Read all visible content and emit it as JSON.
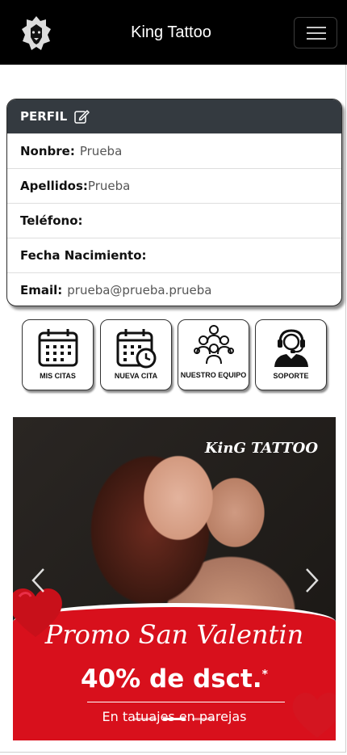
{
  "navbar": {
    "brand": "King Tattoo",
    "logo_icon": "lion-logo-icon",
    "menu_icon": "hamburger-icon"
  },
  "profile": {
    "title": "PERFIL",
    "edit_icon": "edit-icon",
    "fields": [
      {
        "label": "Nonbre:",
        "value": "Prueba"
      },
      {
        "label": "Apellidos:",
        "value": "Prueba"
      },
      {
        "label": "Teléfono:",
        "value": ""
      },
      {
        "label": "Fecha Nacimiento:",
        "value": ""
      },
      {
        "label": "Email:",
        "value": "prueba@prueba.prueba"
      }
    ]
  },
  "actions": [
    {
      "label": "MIS CITAS",
      "icon": "calendar-icon"
    },
    {
      "label": "NUEVA CITA",
      "icon": "calendar-clock-icon"
    },
    {
      "label": "NUESTRO EQUIPO",
      "icon": "team-icon"
    },
    {
      "label": "SOPORTE",
      "icon": "support-headset-icon"
    }
  ],
  "banner": {
    "brand": "KinG TATTOO",
    "promo": "Promo San Valentin",
    "discount": "40% de dsct.",
    "discount_mark": "*",
    "subtitle": "En tatuajes en parejas",
    "prev_icon": "chevron-left-icon",
    "next_icon": "chevron-right-icon",
    "active_slide": 2,
    "slide_count": 3
  },
  "colors": {
    "navbar": "#000000",
    "card_header": "#343a40",
    "promo_red": "#d8101c"
  }
}
